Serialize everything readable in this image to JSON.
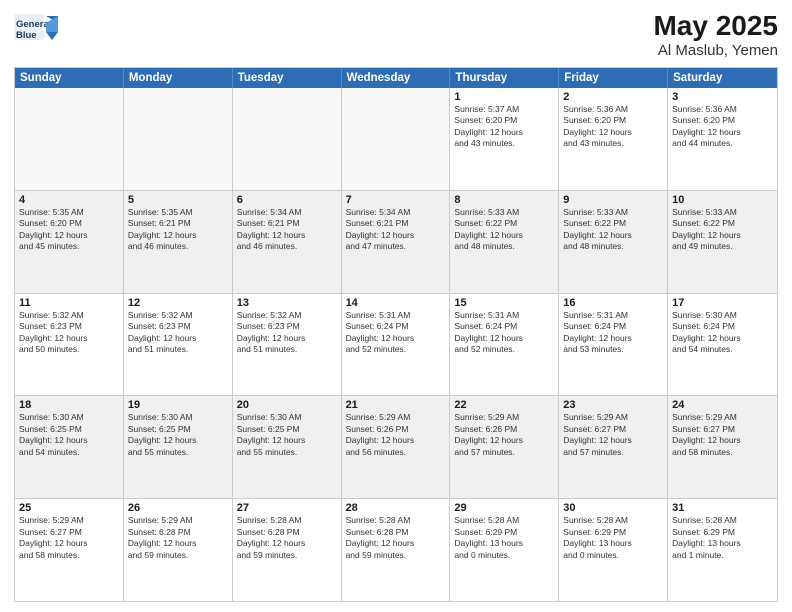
{
  "logo": {
    "line1": "General",
    "line2": "Blue"
  },
  "title": "May 2025",
  "subtitle": "Al Maslub, Yemen",
  "days": [
    "Sunday",
    "Monday",
    "Tuesday",
    "Wednesday",
    "Thursday",
    "Friday",
    "Saturday"
  ],
  "weeks": [
    [
      {
        "day": "",
        "info": ""
      },
      {
        "day": "",
        "info": ""
      },
      {
        "day": "",
        "info": ""
      },
      {
        "day": "",
        "info": ""
      },
      {
        "day": "1",
        "info": "Sunrise: 5:37 AM\nSunset: 6:20 PM\nDaylight: 12 hours\nand 43 minutes."
      },
      {
        "day": "2",
        "info": "Sunrise: 5:36 AM\nSunset: 6:20 PM\nDaylight: 12 hours\nand 43 minutes."
      },
      {
        "day": "3",
        "info": "Sunrise: 5:36 AM\nSunset: 6:20 PM\nDaylight: 12 hours\nand 44 minutes."
      }
    ],
    [
      {
        "day": "4",
        "info": "Sunrise: 5:35 AM\nSunset: 6:20 PM\nDaylight: 12 hours\nand 45 minutes."
      },
      {
        "day": "5",
        "info": "Sunrise: 5:35 AM\nSunset: 6:21 PM\nDaylight: 12 hours\nand 46 minutes."
      },
      {
        "day": "6",
        "info": "Sunrise: 5:34 AM\nSunset: 6:21 PM\nDaylight: 12 hours\nand 46 minutes."
      },
      {
        "day": "7",
        "info": "Sunrise: 5:34 AM\nSunset: 6:21 PM\nDaylight: 12 hours\nand 47 minutes."
      },
      {
        "day": "8",
        "info": "Sunrise: 5:33 AM\nSunset: 6:22 PM\nDaylight: 12 hours\nand 48 minutes."
      },
      {
        "day": "9",
        "info": "Sunrise: 5:33 AM\nSunset: 6:22 PM\nDaylight: 12 hours\nand 48 minutes."
      },
      {
        "day": "10",
        "info": "Sunrise: 5:33 AM\nSunset: 6:22 PM\nDaylight: 12 hours\nand 49 minutes."
      }
    ],
    [
      {
        "day": "11",
        "info": "Sunrise: 5:32 AM\nSunset: 6:23 PM\nDaylight: 12 hours\nand 50 minutes."
      },
      {
        "day": "12",
        "info": "Sunrise: 5:32 AM\nSunset: 6:23 PM\nDaylight: 12 hours\nand 51 minutes."
      },
      {
        "day": "13",
        "info": "Sunrise: 5:32 AM\nSunset: 6:23 PM\nDaylight: 12 hours\nand 51 minutes."
      },
      {
        "day": "14",
        "info": "Sunrise: 5:31 AM\nSunset: 6:24 PM\nDaylight: 12 hours\nand 52 minutes."
      },
      {
        "day": "15",
        "info": "Sunrise: 5:31 AM\nSunset: 6:24 PM\nDaylight: 12 hours\nand 52 minutes."
      },
      {
        "day": "16",
        "info": "Sunrise: 5:31 AM\nSunset: 6:24 PM\nDaylight: 12 hours\nand 53 minutes."
      },
      {
        "day": "17",
        "info": "Sunrise: 5:30 AM\nSunset: 6:24 PM\nDaylight: 12 hours\nand 54 minutes."
      }
    ],
    [
      {
        "day": "18",
        "info": "Sunrise: 5:30 AM\nSunset: 6:25 PM\nDaylight: 12 hours\nand 54 minutes."
      },
      {
        "day": "19",
        "info": "Sunrise: 5:30 AM\nSunset: 6:25 PM\nDaylight: 12 hours\nand 55 minutes."
      },
      {
        "day": "20",
        "info": "Sunrise: 5:30 AM\nSunset: 6:25 PM\nDaylight: 12 hours\nand 55 minutes."
      },
      {
        "day": "21",
        "info": "Sunrise: 5:29 AM\nSunset: 6:26 PM\nDaylight: 12 hours\nand 56 minutes."
      },
      {
        "day": "22",
        "info": "Sunrise: 5:29 AM\nSunset: 6:26 PM\nDaylight: 12 hours\nand 57 minutes."
      },
      {
        "day": "23",
        "info": "Sunrise: 5:29 AM\nSunset: 6:27 PM\nDaylight: 12 hours\nand 57 minutes."
      },
      {
        "day": "24",
        "info": "Sunrise: 5:29 AM\nSunset: 6:27 PM\nDaylight: 12 hours\nand 58 minutes."
      }
    ],
    [
      {
        "day": "25",
        "info": "Sunrise: 5:29 AM\nSunset: 6:27 PM\nDaylight: 12 hours\nand 58 minutes."
      },
      {
        "day": "26",
        "info": "Sunrise: 5:29 AM\nSunset: 6:28 PM\nDaylight: 12 hours\nand 59 minutes."
      },
      {
        "day": "27",
        "info": "Sunrise: 5:28 AM\nSunset: 6:28 PM\nDaylight: 12 hours\nand 59 minutes."
      },
      {
        "day": "28",
        "info": "Sunrise: 5:28 AM\nSunset: 6:28 PM\nDaylight: 12 hours\nand 59 minutes."
      },
      {
        "day": "29",
        "info": "Sunrise: 5:28 AM\nSunset: 6:29 PM\nDaylight: 13 hours\nand 0 minutes."
      },
      {
        "day": "30",
        "info": "Sunrise: 5:28 AM\nSunset: 6:29 PM\nDaylight: 13 hours\nand 0 minutes."
      },
      {
        "day": "31",
        "info": "Sunrise: 5:28 AM\nSunset: 6:29 PM\nDaylight: 13 hours\nand 1 minute."
      }
    ]
  ]
}
